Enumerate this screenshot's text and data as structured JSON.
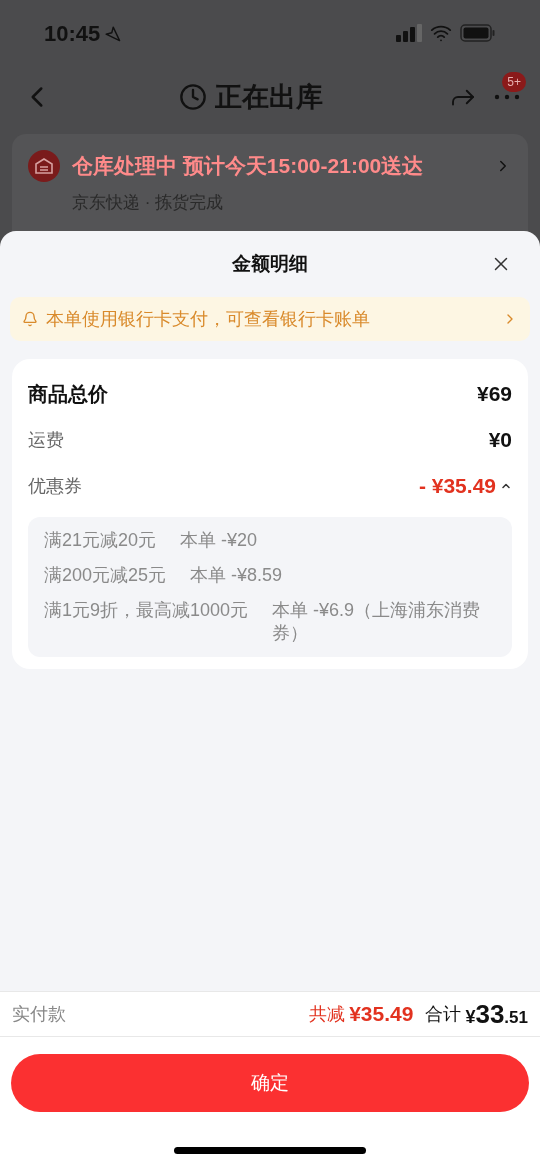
{
  "status_bar": {
    "time": "10:45"
  },
  "nav": {
    "title": "正在出库",
    "badge": "5+"
  },
  "order_card": {
    "headline": "仓库处理中 预计今天15:00-21:00送达",
    "subline": "京东快递 · 拣货完成"
  },
  "sheet": {
    "title": "金额明细",
    "notice": "本单使用银行卡支付，可查看银行卡账单",
    "rows": [
      {
        "kind": "total",
        "label": "商品总价",
        "value": "¥69"
      },
      {
        "kind": "plain",
        "label": "运费",
        "value": "¥0"
      },
      {
        "kind": "discount",
        "label": "优惠券",
        "value": "- ¥35.49",
        "expanded": true
      }
    ],
    "coupons": [
      {
        "rule": "满21元减20元",
        "amount": "本单 -¥20"
      },
      {
        "rule": "满200元减25元",
        "amount": "本单 -¥8.59"
      },
      {
        "rule": "满1元9折，最高减1000元",
        "amount": "本单 -¥6.9（上海浦东消费券）"
      }
    ]
  },
  "footer": {
    "label": "实付款",
    "saved_label": "共减",
    "saved_value": "¥35.49",
    "total_label": "合计",
    "total_currency": "¥",
    "total_integer": "33",
    "total_decimal": ".51",
    "confirm": "确定"
  }
}
